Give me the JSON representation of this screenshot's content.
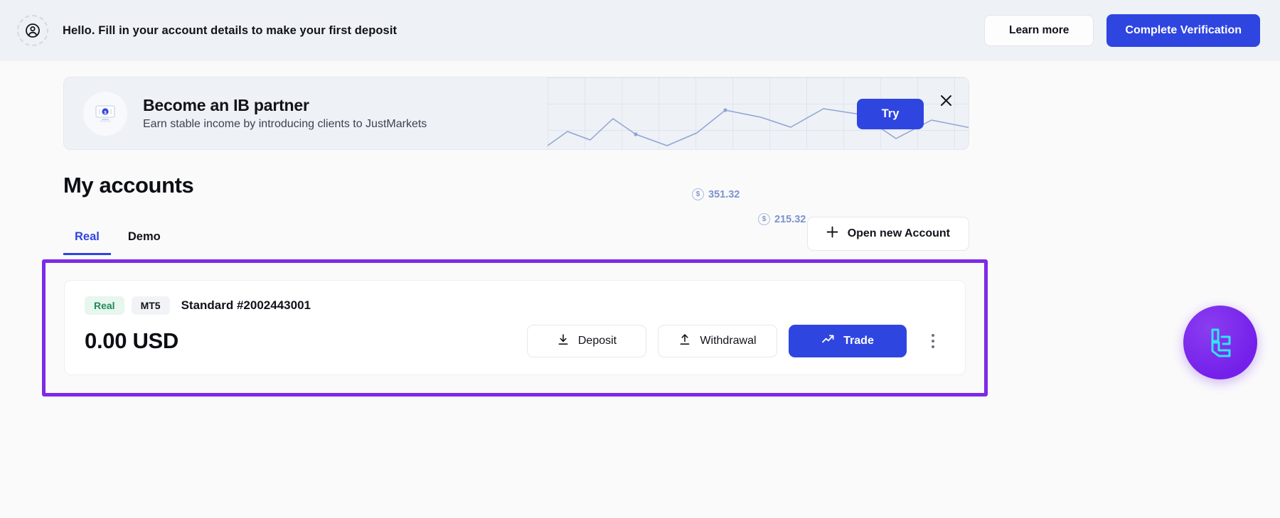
{
  "topbar": {
    "avatar_icon": "user-circle-icon",
    "message": "Hello. Fill in your account details to make your first deposit",
    "learn_more_label": "Learn more",
    "verify_label": "Complete Verification",
    "verify_color": "#2f45e0"
  },
  "ib_banner": {
    "illustration_icon": "banknote-monitor-icon",
    "title": "Become an IB partner",
    "subtitle": "Earn stable income by introducing clients to JustMarkets",
    "try_label": "Try",
    "close_icon": "close-icon",
    "price_tags": [
      {
        "currency_icon": "dollar-circle-icon",
        "value": "351.32"
      },
      {
        "currency_icon": "dollar-circle-icon",
        "value": "215.32"
      }
    ],
    "accent_color": "#2f45e0",
    "chart_line_color": "#8fa5d4"
  },
  "main": {
    "page_title": "My accounts",
    "tabs": [
      {
        "label": "Real",
        "active": true
      },
      {
        "label": "Demo",
        "active": false
      }
    ],
    "open_account": {
      "icon": "plus-icon",
      "label": "Open new Account"
    },
    "highlight_color": "#7c2ae8"
  },
  "account": {
    "badge_type": "Real",
    "badge_platform": "MT5",
    "name": "Standard #2002443001",
    "balance": "0.00 USD",
    "actions": [
      {
        "icon": "download-icon",
        "label": "Deposit"
      },
      {
        "icon": "upload-icon",
        "label": "Withdrawal"
      }
    ],
    "trade": {
      "icon": "trending-up-icon",
      "label": "Trade"
    },
    "more_icon": "three-dots-vertical-icon"
  },
  "chat_widget": {
    "icon": "chat-logo-icon",
    "background_color": "#7420ea",
    "glyph_color": "#2fe6f5"
  }
}
